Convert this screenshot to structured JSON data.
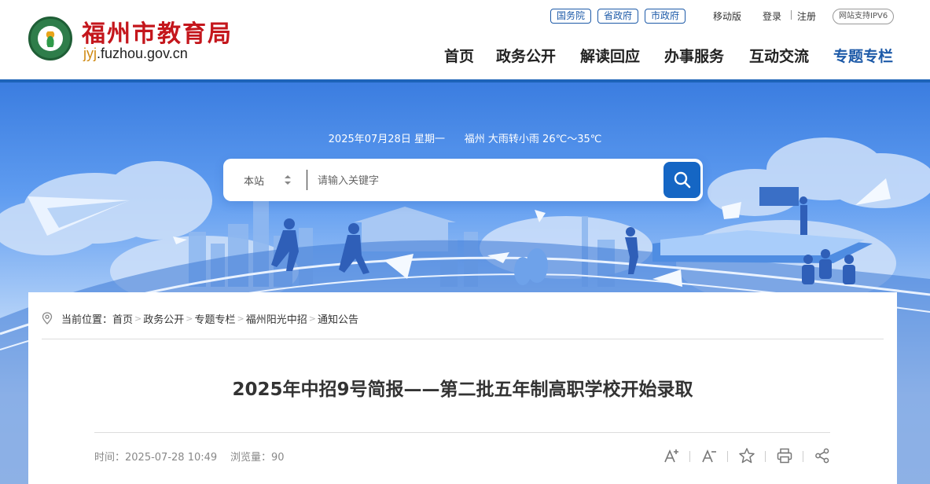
{
  "header": {
    "site_title": "福州市教育局",
    "domain_prefix": "jyj",
    "domain_rest": ".fuzhou.gov.cn",
    "gov_links": [
      "国务院",
      "省政府",
      "市政府"
    ],
    "mobile_label": "移动版",
    "login_label": "登录",
    "register_label": "注册",
    "ipv6_label": "网站支持IPV6",
    "nav": [
      {
        "label": "首页"
      },
      {
        "label": "政务公开"
      },
      {
        "label": "解读回应"
      },
      {
        "label": "办事服务"
      },
      {
        "label": "互动交流"
      },
      {
        "label": "专题专栏",
        "active": true
      }
    ],
    "colors": {
      "title_red": "#c4161c",
      "brand_blue": "#1d5aa8"
    }
  },
  "banner": {
    "date": "2025年07月28日",
    "weekday": "星期一",
    "weather": "福州 大雨转小雨 26℃～35℃",
    "search_scope": "本站",
    "search_placeholder": "请输入关键字",
    "search_icon": "search-icon"
  },
  "breadcrumb": {
    "prefix": "当前位置：",
    "items": [
      "首页",
      "政务公开",
      "专题专栏",
      "福州阳光中招",
      "通知公告"
    ],
    "separator": ">"
  },
  "article": {
    "title": "2025年中招9号简报——第二批五年制高职学校开始录取",
    "time_label": "时间：",
    "time_value": "2025-07-28 10:49",
    "views_label": "浏览量：",
    "views_value": "90",
    "tools": [
      "font-increase-icon",
      "font-decrease-icon",
      "favorite-star-icon",
      "print-icon",
      "share-icon"
    ]
  }
}
